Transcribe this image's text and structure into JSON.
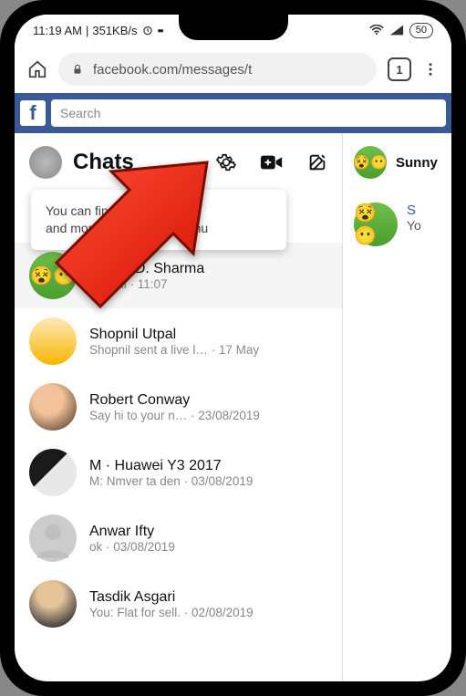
{
  "status": {
    "time": "11:19 AM",
    "net_speed": "351KB/s",
    "battery": "50"
  },
  "browser": {
    "url": "facebook.com/messages/t",
    "tab_count": "1"
  },
  "fb_search_placeholder": "Search",
  "chats_header": {
    "title": "Chats"
  },
  "tooltip": {
    "line1": "You can find settings, help",
    "line2": "and more in the profile menu"
  },
  "chats": [
    {
      "name": "Sunny D. Sharma",
      "sub": "You: hi · 11:07"
    },
    {
      "name": "Shopnil Utpal",
      "sub": "Shopnil sent a live l… · 17 May"
    },
    {
      "name": "Robert Conway",
      "sub": "Say hi to your n… · 23/08/2019"
    },
    {
      "name": "M · Huawei Y3 2017",
      "sub": "M: Nmver ta den · 03/08/2019"
    },
    {
      "name": "Anwar Ifty",
      "sub": "ok · 03/08/2019"
    },
    {
      "name": "Tasdik Asgari",
      "sub": "You: Flat for sell. · 02/08/2019"
    }
  ],
  "side": {
    "contact_label": "Sunny",
    "msg_name_short": "S",
    "msg_preview": "Yo"
  }
}
